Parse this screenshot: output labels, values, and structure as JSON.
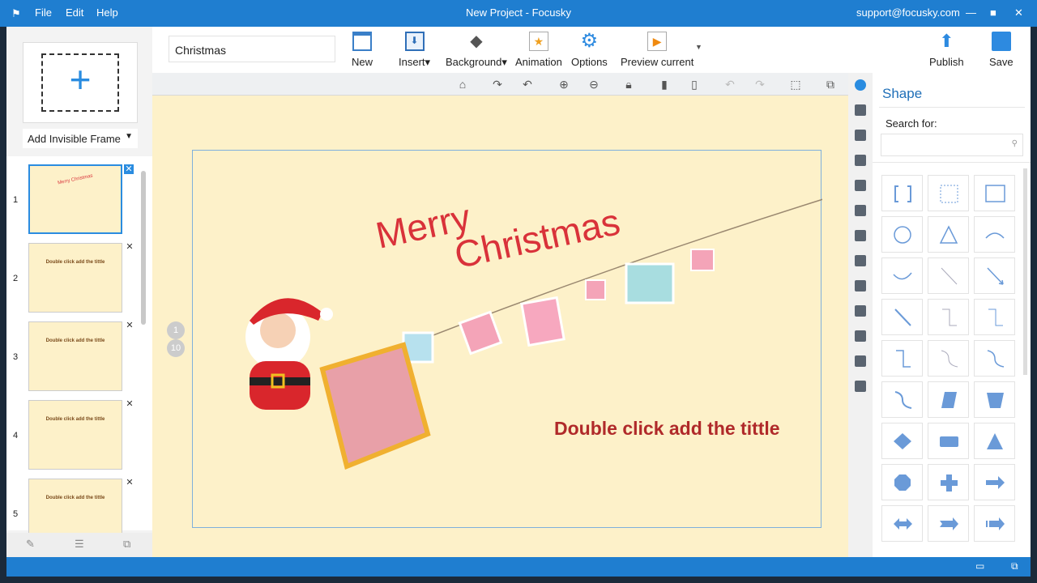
{
  "titlebar": {
    "menus": [
      "File",
      "Edit",
      "Help"
    ],
    "title": "New Project - Focusky",
    "account": "support@focusky.com"
  },
  "left": {
    "add_frame_label": "Add Invisible Frame",
    "slides": [
      {
        "num": "1",
        "title": "Merry Christmas",
        "selected": true
      },
      {
        "num": "2",
        "title": "Double click add the tittle"
      },
      {
        "num": "3",
        "title": "Double click add the tittle"
      },
      {
        "num": "4",
        "title": "Double click add the tittle"
      },
      {
        "num": "5",
        "title": "Double click add the tittle"
      }
    ]
  },
  "toolbar": {
    "project_name": "Christmas",
    "new": "New",
    "insert": "Insert",
    "background": "Background",
    "animation": "Animation",
    "options": "Options",
    "preview": "Preview current",
    "publish": "Publish",
    "save": "Save"
  },
  "subbar": [
    "home-icon",
    "rotate-right-icon",
    "rotate-left-icon",
    "zoom-in-icon",
    "zoom-out-icon",
    "lock-icon",
    "copy-icon",
    "paste-icon",
    "undo-icon",
    "redo-icon",
    "fit-frame-icon",
    "window-icon"
  ],
  "canvas": {
    "title_line1": "Merry",
    "title_line2": "Christmas",
    "subtitle": "Double click add the tittle",
    "path_markers": [
      "1",
      "10"
    ]
  },
  "panel": {
    "title": "Shape",
    "search_label": "Search for:",
    "search_value": "",
    "shapes": [
      "bracket",
      "dotted-rect",
      "rect",
      "circle",
      "triangle",
      "arc",
      "curved-arrow",
      "line",
      "arrow-line",
      "double-arrow-line",
      "elbow",
      "elbow-arrow",
      "elbow-double-arrow",
      "s-curve",
      "s-curve-arrow",
      "s-curve-double-arrow",
      "parallelogram",
      "trapezoid",
      "diamond",
      "rounded-rect",
      "filled-triangle",
      "octagon",
      "cross",
      "right-arrow",
      "left-right-arrow",
      "chevron-arrow",
      "striped-arrow"
    ]
  },
  "side_tabs": [
    "shape",
    "image",
    "text",
    "video",
    "music",
    "link",
    "plane",
    "flash",
    "people",
    "hat",
    "layers",
    "layout",
    "archive"
  ],
  "colors": {
    "accent": "#1f7ed0",
    "title_red": "#d9323a",
    "subtitle_red": "#b02a2a",
    "shape_blue": "#6a9ad8"
  }
}
